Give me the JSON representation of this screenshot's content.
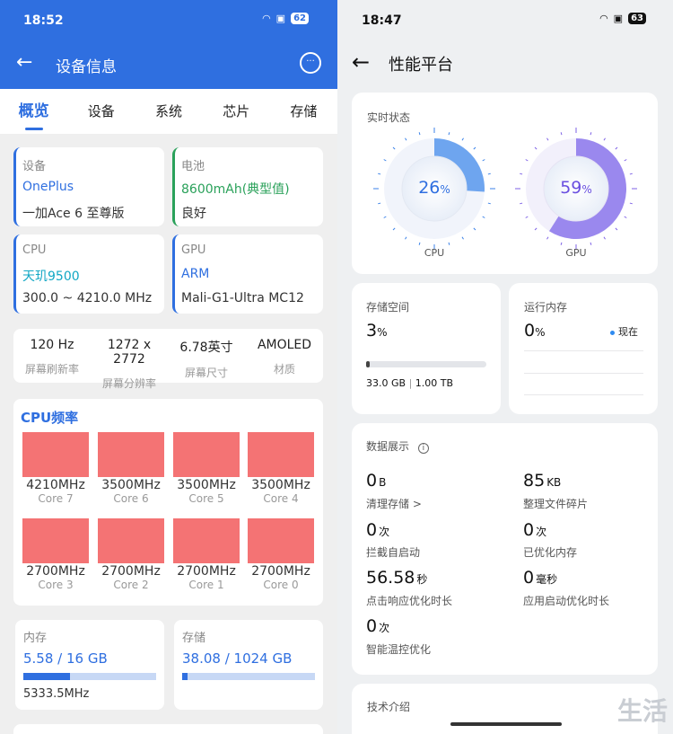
{
  "left": {
    "status_time": "18:52",
    "battery": "62",
    "title": "设备信息",
    "tabs": [
      "概览",
      "设备",
      "系统",
      "芯片",
      "存储"
    ],
    "device": {
      "caption": "设备",
      "brand": "OnePlus",
      "model": "一加Ace 6 至尊版"
    },
    "battery_card": {
      "caption": "电池",
      "capacity": "8600mAh(典型值)",
      "health": "良好"
    },
    "cpu": {
      "caption": "CPU",
      "name": "天玑9500",
      "range": "300.0 ~ 4210.0 MHz"
    },
    "gpu": {
      "caption": "GPU",
      "name": "ARM",
      "model": "Mali-G1-Ultra MC12"
    },
    "screen": [
      {
        "value": "120 Hz",
        "label": "屏幕刷新率"
      },
      {
        "value": "1272 x 2772",
        "label": "屏幕分辨率"
      },
      {
        "value": "6.78英寸",
        "label": "屏幕尺寸"
      },
      {
        "value": "AMOLED",
        "label": "材质"
      }
    ],
    "cpu_freq_title": "CPU频率",
    "cores": [
      {
        "freq": "4210MHz",
        "name": "Core 7"
      },
      {
        "freq": "3500MHz",
        "name": "Core 6"
      },
      {
        "freq": "3500MHz",
        "name": "Core 5"
      },
      {
        "freq": "3500MHz",
        "name": "Core 4"
      },
      {
        "freq": "2700MHz",
        "name": "Core 3"
      },
      {
        "freq": "2700MHz",
        "name": "Core 2"
      },
      {
        "freq": "2700MHz",
        "name": "Core 1"
      },
      {
        "freq": "2700MHz",
        "name": "Core 0"
      }
    ],
    "memory": {
      "caption": "内存",
      "value": "5.58 / 16 GB",
      "fraction": 0.35,
      "freq": "5333.5MHz"
    },
    "storage": {
      "caption": "存储",
      "value": "38.08 / 1024 GB",
      "fraction": 0.04
    },
    "colors": {
      "accent": "#2f6fe0",
      "core_block": "#f47374"
    }
  },
  "right": {
    "status_time": "18:47",
    "battery": "63",
    "title": "性能平台",
    "realtime_caption": "实时状态",
    "cpu_percent": "26",
    "gpu_percent": "59",
    "percent_unit": "%",
    "cpu_label": "CPU",
    "gpu_label": "GPU",
    "storage": {
      "caption": "存储空间",
      "percent": "3",
      "unit": "%",
      "used": "33.0 GB",
      "sep": "|",
      "total": "1.00 TB",
      "fraction": 0.03
    },
    "ram": {
      "caption": "运行内存",
      "percent": "0",
      "unit": "%",
      "legend": "现在"
    },
    "data_caption": "数据展示",
    "stats": [
      {
        "value": "0",
        "unit": "B",
        "label": "清理存储 >"
      },
      {
        "value": "85",
        "unit": "KB",
        "label": "整理文件碎片"
      },
      {
        "value": "0",
        "unit": "次",
        "label": "拦截自启动"
      },
      {
        "value": "0",
        "unit": "次",
        "label": "已优化内存"
      },
      {
        "value": "56.58",
        "unit": "秒",
        "label": "点击响应优化时长"
      },
      {
        "value": "0",
        "unit": "毫秒",
        "label": "应用启动优化时长"
      },
      {
        "value": "0",
        "unit": "次",
        "label": "智能温控优化"
      }
    ],
    "tech_caption": "技术介绍",
    "watermark": "生活",
    "colors": {
      "cpu_ring": "#3b82e8",
      "gpu_ring": "#7e62e6"
    }
  }
}
